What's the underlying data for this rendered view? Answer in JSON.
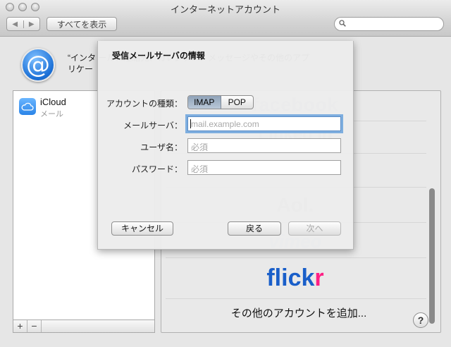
{
  "window": {
    "title": "インターネットアカウント"
  },
  "toolbar": {
    "show_all_label": "すべてを表示",
    "back_glyph": "◀",
    "forward_glyph": "▶",
    "search_placeholder": ""
  },
  "header": {
    "icon_glyph": "@",
    "desc_line1": "“インタ                             ール、連絡先、カレンダー、メッセージやその他のアプ",
    "desc_line2": "リケー"
  },
  "accounts": [
    {
      "name": "iCloud",
      "subtitle": "メール"
    }
  ],
  "list_footer": {
    "add": "+",
    "remove": "−"
  },
  "providers": {
    "facebook": "facebook",
    "linkedin": "Linked in",
    "aol": "Aol.",
    "vimeo": "vimeo",
    "flickr_part1": "flick",
    "flickr_part2": "r",
    "add_other": "その他のアカウントを追加...",
    "help": "?"
  },
  "sheet": {
    "title": "受信メールサーバの情報",
    "account_type_label": "アカウントの種類：",
    "account_type_options": [
      "IMAP",
      "POP"
    ],
    "account_type_selected": "IMAP",
    "server_label": "メールサーバ：",
    "server_placeholder": "mail.example.com",
    "username_label": "ユーザ名：",
    "username_placeholder": "必須",
    "password_label": "パスワード：",
    "password_placeholder": "必須",
    "cancel_label": "キャンセル",
    "back_label": "戻る",
    "next_label": "次へ"
  },
  "colors": {
    "accent": "#1a6fd6",
    "flickr_blue": "#1a5fc9",
    "flickr_pink": "#ff1f85",
    "focus_ring": "#7eaedf"
  }
}
